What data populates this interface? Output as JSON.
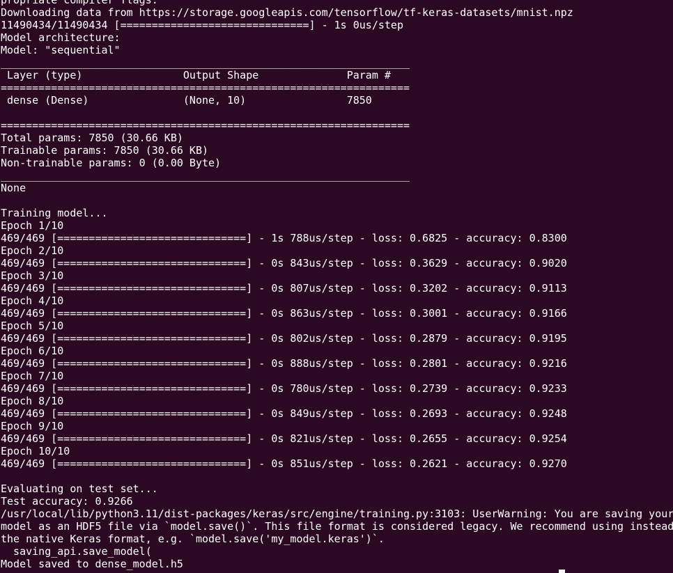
{
  "terminal": {
    "lines": [
      "propriate compiler flags.",
      "Downloading data from https://storage.googleapis.com/tensorflow/tf-keras-datasets/mnist.npz",
      "11490434/11490434 [==============================] - 1s 0us/step",
      "Model architecture:",
      "Model: \"sequential\"",
      "_________________________________________________________________",
      " Layer (type)                Output Shape              Param #",
      "=================================================================",
      " dense (Dense)               (None, 10)                7850",
      "",
      "=================================================================",
      "Total params: 7850 (30.66 KB)",
      "Trainable params: 7850 (30.66 KB)",
      "Non-trainable params: 0 (0.00 Byte)",
      "_________________________________________________________________",
      "None",
      "",
      "Training model...",
      "Epoch 1/10",
      "469/469 [==============================] - 1s 788us/step - loss: 0.6825 - accuracy: 0.8300",
      "Epoch 2/10",
      "469/469 [==============================] - 0s 843us/step - loss: 0.3629 - accuracy: 0.9020",
      "Epoch 3/10",
      "469/469 [==============================] - 0s 807us/step - loss: 0.3202 - accuracy: 0.9113",
      "Epoch 4/10",
      "469/469 [==============================] - 0s 863us/step - loss: 0.3001 - accuracy: 0.9166",
      "Epoch 5/10",
      "469/469 [==============================] - 0s 802us/step - loss: 0.2879 - accuracy: 0.9195",
      "Epoch 6/10",
      "469/469 [==============================] - 0s 888us/step - loss: 0.2801 - accuracy: 0.9216",
      "Epoch 7/10",
      "469/469 [==============================] - 0s 780us/step - loss: 0.2739 - accuracy: 0.9233",
      "Epoch 8/10",
      "469/469 [==============================] - 0s 849us/step - loss: 0.2693 - accuracy: 0.9248",
      "Epoch 9/10",
      "469/469 [==============================] - 0s 821us/step - loss: 0.2655 - accuracy: 0.9254",
      "Epoch 10/10",
      "469/469 [==============================] - 0s 851us/step - loss: 0.2621 - accuracy: 0.9270",
      "",
      "Evaluating on test set...",
      "Test accuracy: 0.9266",
      "/usr/local/lib/python3.11/dist-packages/keras/src/engine/training.py:3103: UserWarning: You are saving your",
      "model as an HDF5 file via `model.save()`. This file format is considered legacy. We recommend using instead",
      "the native Keras format, e.g. `model.save('my_model.keras')`.",
      "  saving_api.save_model(",
      "Model saved to dense_model.h5"
    ]
  }
}
